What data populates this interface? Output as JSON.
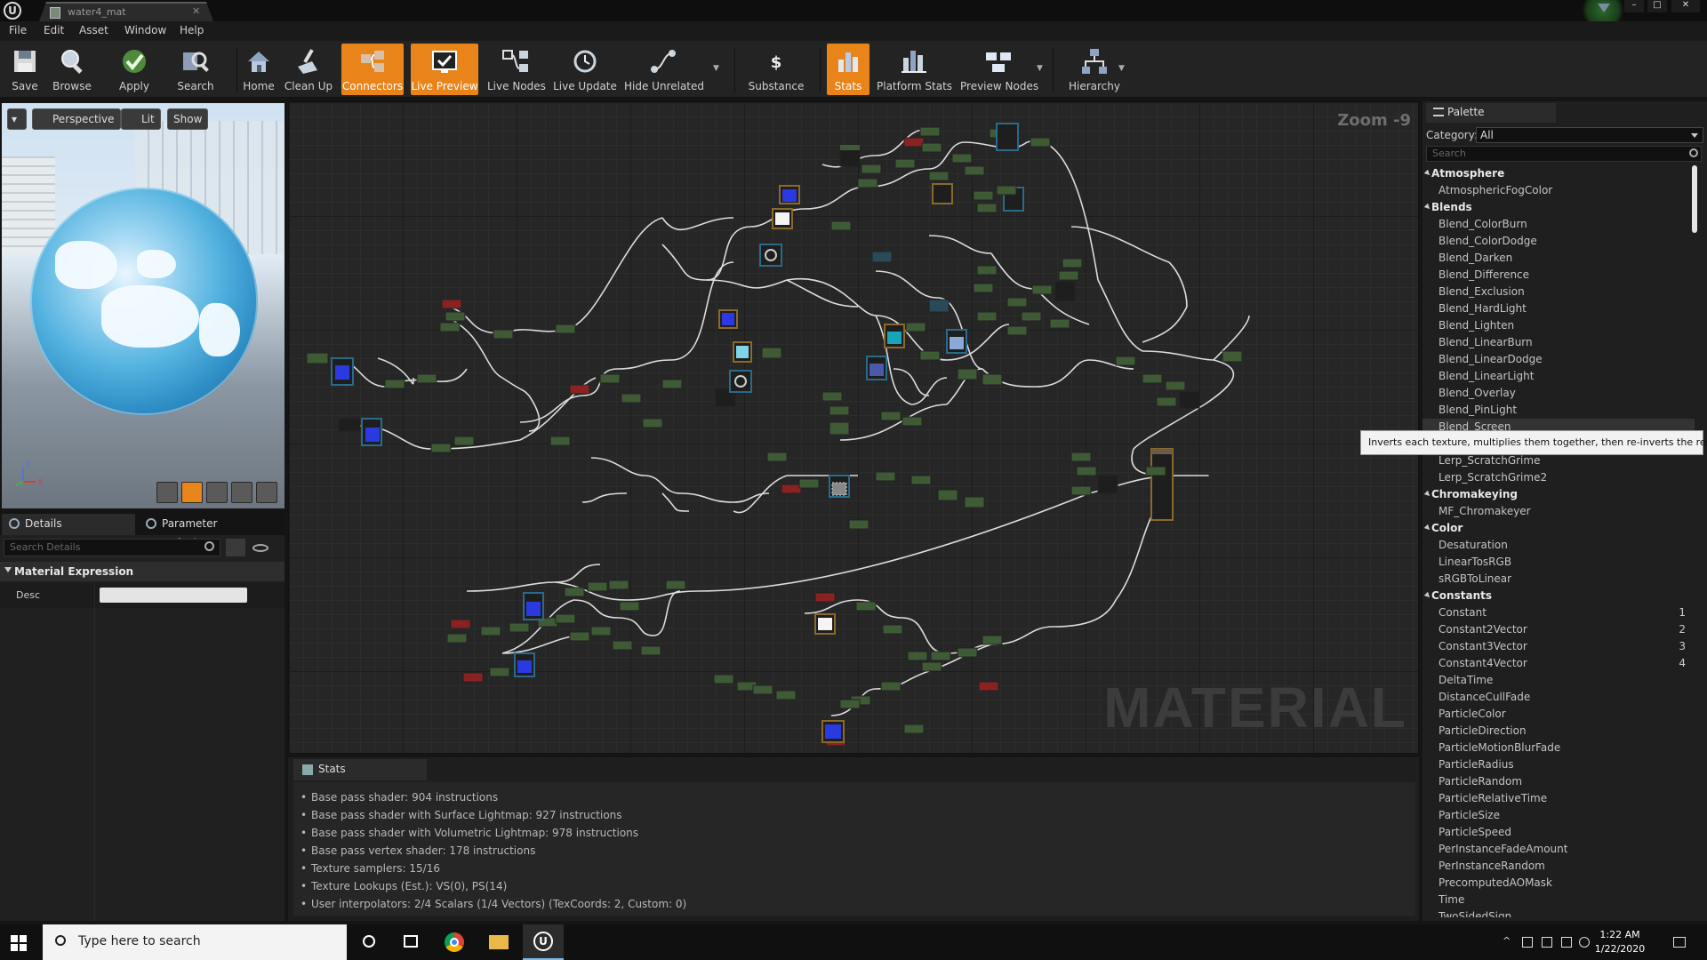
{
  "window": {
    "tab_title": "water4_mat",
    "logo_glyph": "U",
    "controls": {
      "minimize": "–",
      "maximize": "□",
      "close": "✕"
    }
  },
  "menu": [
    "File",
    "Edit",
    "Asset",
    "Window",
    "Help"
  ],
  "toolbar": {
    "buttons": [
      {
        "label": "Save",
        "icon": "save-icon"
      },
      {
        "label": "Browse",
        "icon": "browse-icon"
      },
      {
        "label": "Apply",
        "icon": "apply-icon"
      },
      {
        "label": "Search",
        "icon": "search-icon"
      },
      {
        "label": "Home",
        "icon": "home-icon"
      },
      {
        "label": "Clean Up",
        "icon": "clean-up-icon"
      },
      {
        "label": "Connectors",
        "icon": "connectors-icon",
        "active": true
      },
      {
        "label": "Live Preview",
        "icon": "live-preview-icon",
        "active": true
      },
      {
        "label": "Live Nodes",
        "icon": "live-nodes-icon"
      },
      {
        "label": "Live Update",
        "icon": "live-update-icon"
      },
      {
        "label": "Hide Unrelated",
        "icon": "hide-unrelated-icon"
      },
      {
        "label": "Substance",
        "icon": "substance-icon"
      },
      {
        "label": "Stats",
        "icon": "stats-icon",
        "active": true
      },
      {
        "label": "Platform Stats",
        "icon": "platform-stats-icon"
      },
      {
        "label": "Preview Nodes",
        "icon": "preview-nodes-icon"
      },
      {
        "label": "Hierarchy",
        "icon": "hierarchy-icon"
      }
    ],
    "accent": "#e8841a"
  },
  "viewport": {
    "perspective": "Perspective",
    "lit": "Lit",
    "show": "Show",
    "axis_z": "Z",
    "axis_x": "X"
  },
  "details": {
    "tabs": [
      "Details",
      "Parameter Defaults"
    ],
    "search_placeholder": "Search Details",
    "section": "Material Expression",
    "desc_label": "Desc",
    "desc_value": ""
  },
  "graph": {
    "zoom": "Zoom -9",
    "watermark": "MATERIAL"
  },
  "stats": {
    "tab": "Stats",
    "lines": [
      "Base pass shader: 904 instructions",
      "Base pass shader with Surface Lightmap: 927 instructions",
      "Base pass shader with Volumetric Lightmap: 978 instructions",
      "Base pass vertex shader: 178 instructions",
      "Texture samplers: 15/16",
      "Texture Lookups (Est.): VS(0), PS(14)",
      "User interpolators: 2/4 Scalars (1/4 Vectors) (TexCoords: 2, Custom: 0)"
    ]
  },
  "palette": {
    "tab": "Palette",
    "category_label": "Category:",
    "category_value": "All",
    "search_placeholder": "Search",
    "tooltip": "Inverts each texture, multiplies them together, then re-inverts the results.",
    "rows": [
      {
        "type": "cat",
        "label": "Atmosphere"
      },
      {
        "type": "item",
        "label": "AtmosphericFogColor"
      },
      {
        "type": "cat",
        "label": "Blends"
      },
      {
        "type": "item",
        "label": "Blend_ColorBurn"
      },
      {
        "type": "item",
        "label": "Blend_ColorDodge"
      },
      {
        "type": "item",
        "label": "Blend_Darken"
      },
      {
        "type": "item",
        "label": "Blend_Difference"
      },
      {
        "type": "item",
        "label": "Blend_Exclusion"
      },
      {
        "type": "item",
        "label": "Blend_HardLight"
      },
      {
        "type": "item",
        "label": "Blend_Lighten"
      },
      {
        "type": "item",
        "label": "Blend_LinearBurn"
      },
      {
        "type": "item",
        "label": "Blend_LinearDodge"
      },
      {
        "type": "item",
        "label": "Blend_LinearLight"
      },
      {
        "type": "item",
        "label": "Blend_Overlay"
      },
      {
        "type": "item",
        "label": "Blend_PinLight"
      },
      {
        "type": "item",
        "label": "Blend_Screen",
        "hover": true
      },
      {
        "type": "item",
        "label": ""
      },
      {
        "type": "item",
        "label": "Lerp_ScratchGrime"
      },
      {
        "type": "item",
        "label": "Lerp_ScratchGrime2"
      },
      {
        "type": "cat",
        "label": "Chromakeying"
      },
      {
        "type": "item",
        "label": "MF_Chromakeyer"
      },
      {
        "type": "cat",
        "label": "Color"
      },
      {
        "type": "item",
        "label": "Desaturation"
      },
      {
        "type": "item",
        "label": "LinearTosRGB"
      },
      {
        "type": "item",
        "label": "sRGBToLinear"
      },
      {
        "type": "cat",
        "label": "Constants"
      },
      {
        "type": "item",
        "label": "Constant",
        "key": "1"
      },
      {
        "type": "item",
        "label": "Constant2Vector",
        "key": "2"
      },
      {
        "type": "item",
        "label": "Constant3Vector",
        "key": "3"
      },
      {
        "type": "item",
        "label": "Constant4Vector",
        "key": "4"
      },
      {
        "type": "item",
        "label": "DeltaTime"
      },
      {
        "type": "item",
        "label": "DistanceCullFade"
      },
      {
        "type": "item",
        "label": "ParticleColor"
      },
      {
        "type": "item",
        "label": "ParticleDirection"
      },
      {
        "type": "item",
        "label": "ParticleMotionBlurFade"
      },
      {
        "type": "item",
        "label": "ParticleRadius"
      },
      {
        "type": "item",
        "label": "ParticleRandom"
      },
      {
        "type": "item",
        "label": "ParticleRelativeTime"
      },
      {
        "type": "item",
        "label": "ParticleSize"
      },
      {
        "type": "item",
        "label": "ParticleSpeed"
      },
      {
        "type": "item",
        "label": "PerInstanceFadeAmount"
      },
      {
        "type": "item",
        "label": "PerInstanceRandom"
      },
      {
        "type": "item",
        "label": "PrecomputedAOMask"
      },
      {
        "type": "item",
        "label": "Time"
      },
      {
        "type": "item",
        "label": "TwoSidedSign"
      }
    ]
  },
  "taskbar": {
    "search_placeholder": "Type here to search",
    "time": "1:22 AM",
    "date": "1/22/2020",
    "apps": [
      "cortana-icon",
      "task-view-icon",
      "chrome-icon",
      "file-explorer-icon",
      "unreal-engine-icon"
    ]
  }
}
